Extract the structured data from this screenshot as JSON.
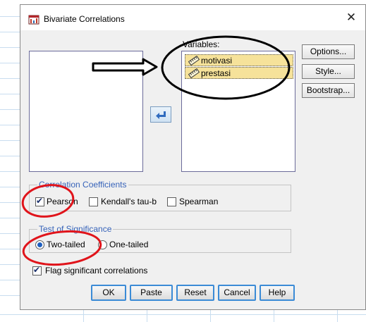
{
  "dialog": {
    "title": "Bivariate Correlations",
    "close_glyph": "✕"
  },
  "variables": {
    "label": "Variables:",
    "items": [
      {
        "name": "motivasi"
      },
      {
        "name": "prestasi"
      }
    ]
  },
  "side_buttons": {
    "options": "Options...",
    "style": "Style...",
    "bootstrap": "Bootstrap..."
  },
  "correlation": {
    "title": "Correlation Coefficients",
    "pearson": {
      "label": "Pearson",
      "checked": true
    },
    "kendall": {
      "label": "Kendall's tau-b",
      "checked": false
    },
    "spearman": {
      "label": "Spearman",
      "checked": false
    }
  },
  "significance": {
    "title": "Test of Significance",
    "two_tailed": {
      "label": "Two-tailed",
      "selected": true
    },
    "one_tailed": {
      "label": "One-tailed",
      "selected": false
    }
  },
  "flag": {
    "label": "Flag significant correlations",
    "checked": true
  },
  "bottom_buttons": {
    "ok": "OK",
    "paste": "Paste",
    "reset": "Reset",
    "cancel": "Cancel",
    "help": "Help"
  },
  "colors": {
    "accent": "#3763b9",
    "highlight": "#f6e29a",
    "annotation": "#e0141b",
    "button_border": "#3b8bd6"
  },
  "icons": [
    "app-icon",
    "ruler-icon",
    "arrow-left-icon",
    "close-icon"
  ]
}
